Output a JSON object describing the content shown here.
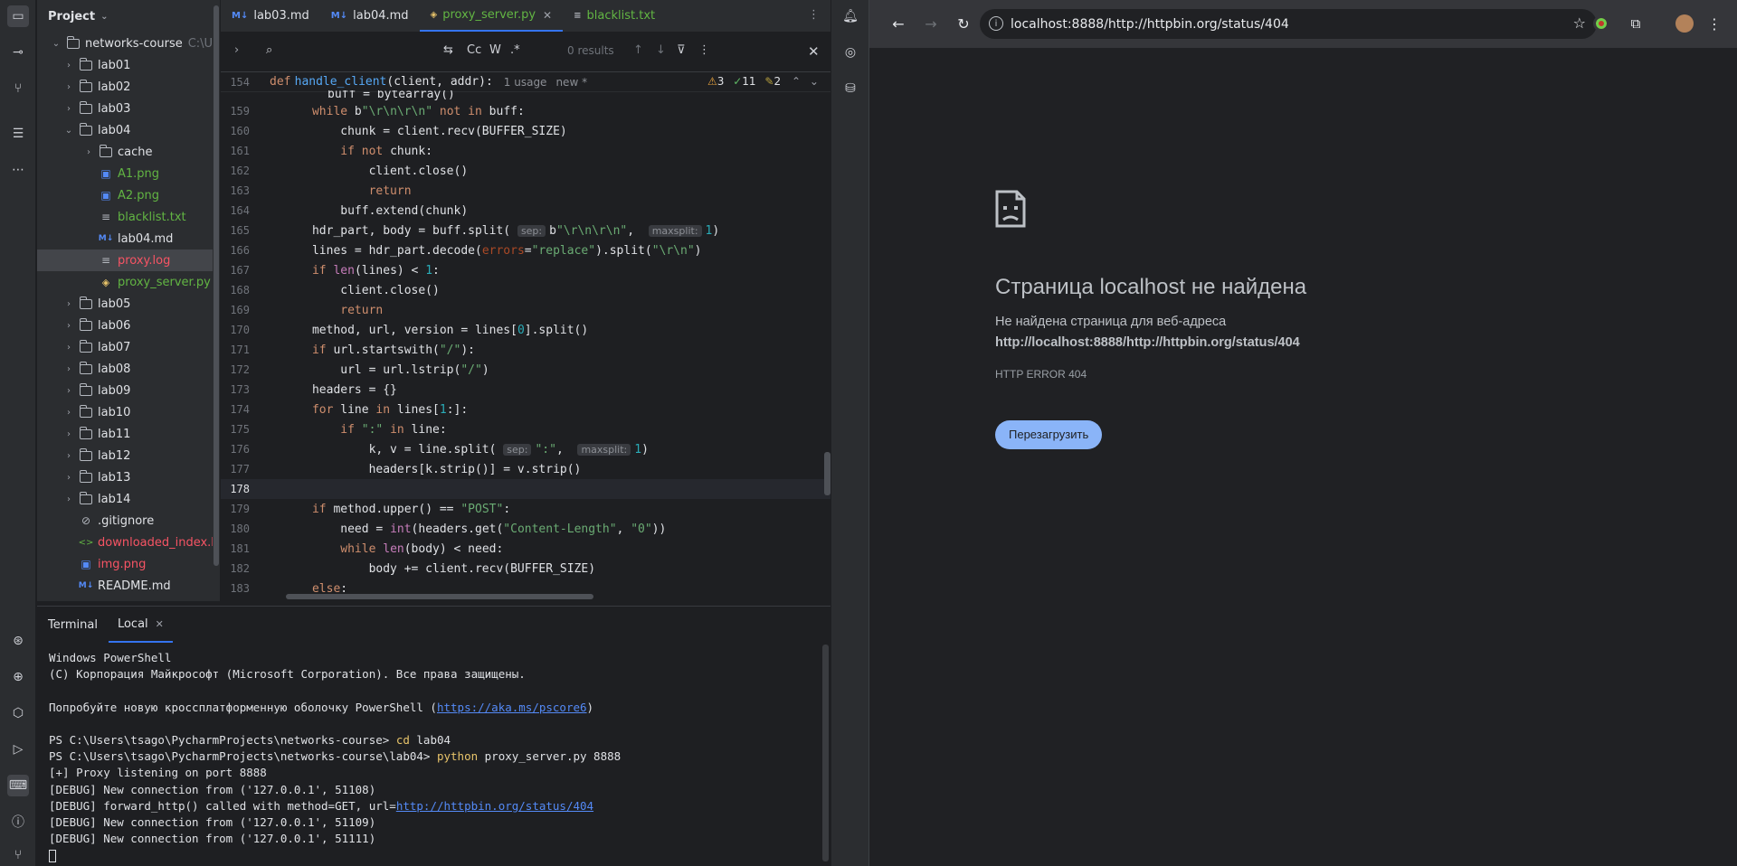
{
  "ide": {
    "project": {
      "title": "Project",
      "root": "networks-course",
      "root_hint": "C:\\Us",
      "items": [
        {
          "label": "lab01",
          "type": "folder",
          "expanded": false
        },
        {
          "label": "lab02",
          "type": "folder",
          "expanded": false
        },
        {
          "label": "lab03",
          "type": "folder",
          "expanded": false
        },
        {
          "label": "lab04",
          "type": "folder",
          "expanded": true
        },
        {
          "label": "cache",
          "type": "folder",
          "expanded": false,
          "child": true
        },
        {
          "label": "A1.png",
          "type": "image",
          "child": true,
          "color": "#62b543"
        },
        {
          "label": "A2.png",
          "type": "image",
          "child": true,
          "color": "#62b543"
        },
        {
          "label": "blacklist.txt",
          "type": "text",
          "child": true,
          "color": "#62b543"
        },
        {
          "label": "lab04.md",
          "type": "md",
          "child": true,
          "color": "#dfe1e5"
        },
        {
          "label": "proxy.log",
          "type": "text",
          "child": true,
          "color": "#f75464",
          "selected": true
        },
        {
          "label": "proxy_server.py",
          "type": "python",
          "child": true,
          "color": "#62b543"
        },
        {
          "label": "lab05",
          "type": "folder",
          "expanded": false
        },
        {
          "label": "lab06",
          "type": "folder",
          "expanded": false
        },
        {
          "label": "lab07",
          "type": "folder",
          "expanded": false
        },
        {
          "label": "lab08",
          "type": "folder",
          "expanded": false
        },
        {
          "label": "lab09",
          "type": "folder",
          "expanded": false
        },
        {
          "label": "lab10",
          "type": "folder",
          "expanded": false
        },
        {
          "label": "lab11",
          "type": "folder",
          "expanded": false
        },
        {
          "label": "lab12",
          "type": "folder",
          "expanded": false
        },
        {
          "label": "lab13",
          "type": "folder",
          "expanded": false
        },
        {
          "label": "lab14",
          "type": "folder",
          "expanded": false
        },
        {
          "label": ".gitignore",
          "type": "ignore",
          "color": "#dfe1e5"
        },
        {
          "label": "downloaded_index.h",
          "type": "html",
          "color": "#f75464"
        },
        {
          "label": "img.png",
          "type": "image",
          "color": "#f75464"
        },
        {
          "label": "README.md",
          "type": "md",
          "color": "#dfe1e5"
        }
      ]
    },
    "tabs": [
      {
        "label": "lab03.md",
        "icon": "M↓",
        "active": false
      },
      {
        "label": "lab04.md",
        "icon": "M↓",
        "active": false
      },
      {
        "label": "proxy_server.py",
        "icon": "py",
        "active": true,
        "color": "#62b543"
      },
      {
        "label": "blacklist.txt",
        "icon": "≡",
        "active": false,
        "color": "#62b543"
      }
    ],
    "find": {
      "results": "0 results",
      "case_label": "Cc",
      "word_label": "W",
      "regex_label": ".*"
    },
    "breadcrumb": {
      "line": "154",
      "signature_kw": "def",
      "signature_fn": "handle_client",
      "signature_args": "(client, addr):",
      "usage": "1 usage",
      "new": "new *",
      "warnings": "3",
      "weak": "11",
      "typos": "2"
    },
    "terminal": {
      "title": "Terminal",
      "tab": "Local",
      "lines": [
        {
          "text": "Windows PowerShell"
        },
        {
          "text": "(C) Корпорация Майкрософт (Microsoft Corporation). Все права защищены."
        },
        {
          "text": ""
        },
        {
          "text": "Попробуйте новую кроссплатформенную оболочку PowerShell (",
          "link": "https://aka.ms/pscore6",
          "after": ")"
        },
        {
          "text": ""
        },
        {
          "text": "PS C:\\Users\\tsago\\PycharmProjects\\networks-course> ",
          "cmd": "cd",
          "after": " lab04"
        },
        {
          "text": "PS C:\\Users\\tsago\\PycharmProjects\\networks-course\\lab04> ",
          "cmd": "python",
          "after": " proxy_server.py 8888"
        },
        {
          "text": "[+] Proxy listening on port 8888"
        },
        {
          "text": "[DEBUG] New connection from ('127.0.0.1', 51108)"
        },
        {
          "text": "[DEBUG] forward_http() called with method=GET, url=",
          "link": "http://httpbin.org/status/404"
        },
        {
          "text": "[DEBUG] New connection from ('127.0.0.1', 51109)"
        },
        {
          "text": "[DEBUG] New connection from ('127.0.0.1', 51111)"
        }
      ]
    }
  },
  "browser": {
    "url": "localhost:8888/http://httpbin.org/status/404",
    "error_title": "Страница localhost не найдена",
    "error_desc": "Не найдена страница для веб-адреса",
    "error_url": "http://localhost:8888/http://httpbin.org/status/404",
    "error_code": "HTTP ERROR 404",
    "reload_label": "Перезагрузить",
    "accent": "#8ab4f8"
  }
}
